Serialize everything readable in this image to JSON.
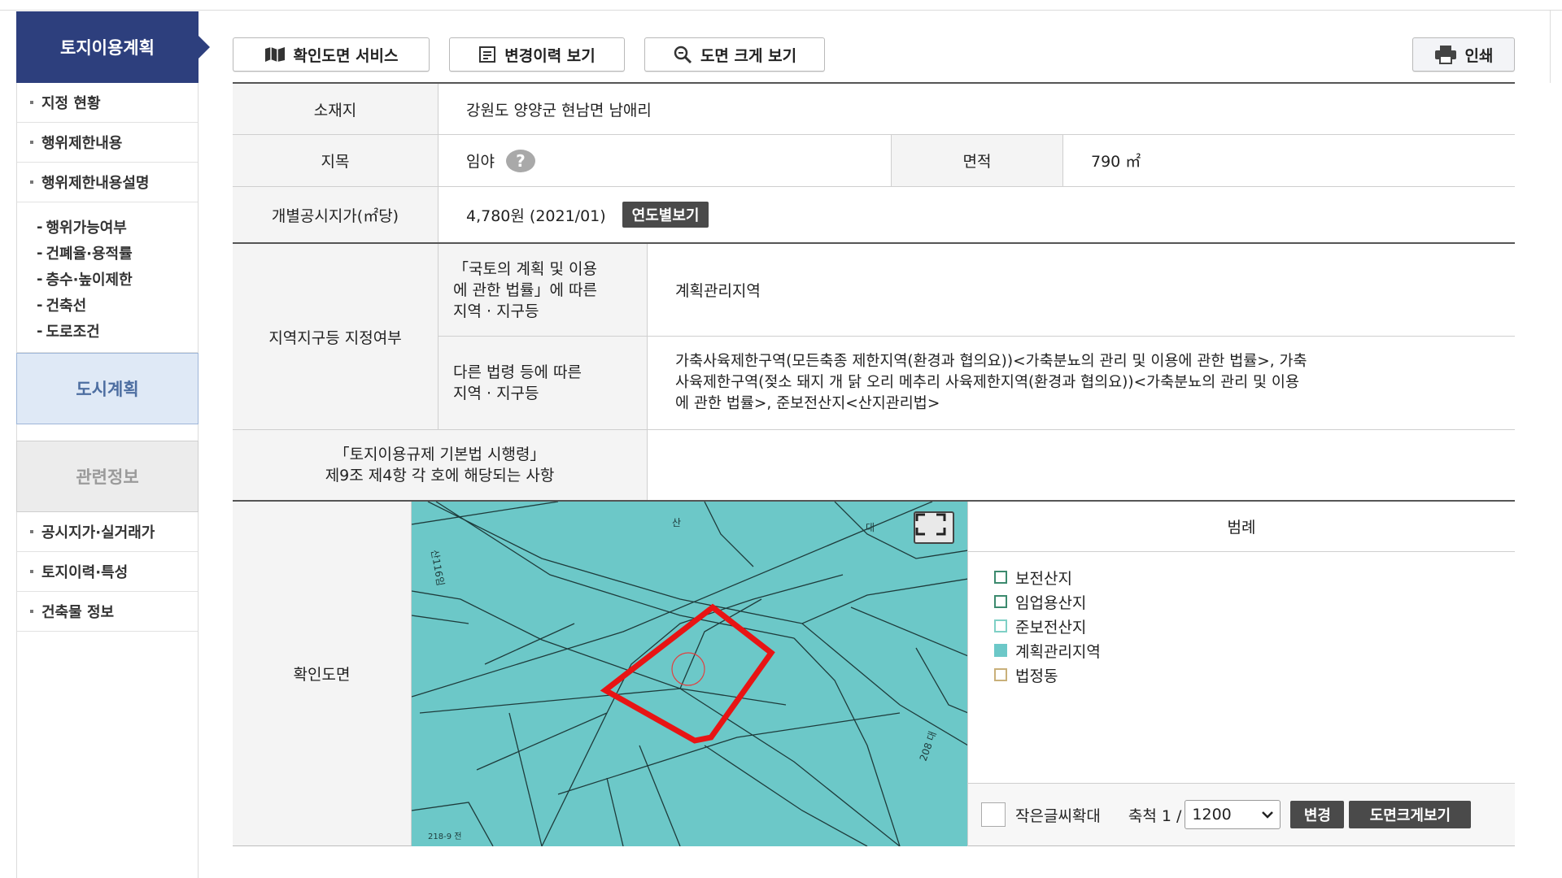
{
  "sidebar": {
    "header": "토지이용계획",
    "items_top": [
      "지정 현황",
      "행위제한내용",
      "행위제한내용설명"
    ],
    "sub_items": [
      "행위가능여부",
      "건폐율·용적률",
      "층수·높이제한",
      "건축선",
      "도로조건"
    ],
    "city_plan": "도시계획",
    "related_info": "관련정보",
    "items_bottom": [
      "공시지가·실거래가",
      "토지이력·특성",
      "건축물 정보"
    ]
  },
  "toolbar": {
    "confirm_map": "확인도면 서비스",
    "change_history": "변경이력 보기",
    "zoom_map": "도면 크게 보기",
    "print": "인쇄"
  },
  "table": {
    "location_label": "소재지",
    "location_value": "강원도 양양군 현남면 남애리",
    "category_label": "지목",
    "category_value": "임야",
    "help_symbol": "?",
    "area_label": "면적",
    "area_value": "790 ㎡",
    "price_label": "개별공시지가(㎡당)",
    "price_value": "4,780원 (2021/01)",
    "yearly_btn": "연도별보기",
    "zone_label": "지역지구등 지정여부",
    "national_law_label": [
      "「국토의 계획 및 이용",
      "에 관한 법률」에 따른",
      "지역 · 지구등"
    ],
    "national_law_value": "계획관리지역",
    "other_law_label": [
      "다른 법령 등에 따른",
      "지역 · 지구등"
    ],
    "other_law_value": [
      "가축사육제한구역(모든축종 제한지역(환경과 협의요))<가축분뇨의 관리 및 이용에 관한 법률>, 가축",
      "사육제한구역(젖소 돼지 개 닭 오리 메추리 사육제한지역(환경과 협의요))<가축분뇨의 관리 및 이용",
      "에 관한 법률>, 준보전산지<산지관리법>"
    ],
    "regulation_label": [
      "「토지이용규제 기본법 시행령」",
      "제9조 제4항 각 호에 해당되는 사항"
    ],
    "map_label": "확인도면"
  },
  "map": {
    "labels": [
      "대",
      "208 대",
      "218-9 전",
      "산116임",
      "산"
    ]
  },
  "legend": {
    "title": "범례",
    "items": [
      {
        "label": "보전산지",
        "color": "#ffffff"
      },
      {
        "label": "임업용산지",
        "color": "#ffffff"
      },
      {
        "label": "준보전산지",
        "color": "#ffffff"
      },
      {
        "label": "계획관리지역",
        "color": "#6cc8c8"
      },
      {
        "label": "법정동",
        "color": "#ffffff"
      }
    ],
    "small_text": "작은글씨확대",
    "scale_label": "축척 1 /",
    "scale_value": "1200",
    "change_btn": "변경",
    "zoom_btn": "도면크게보기"
  }
}
